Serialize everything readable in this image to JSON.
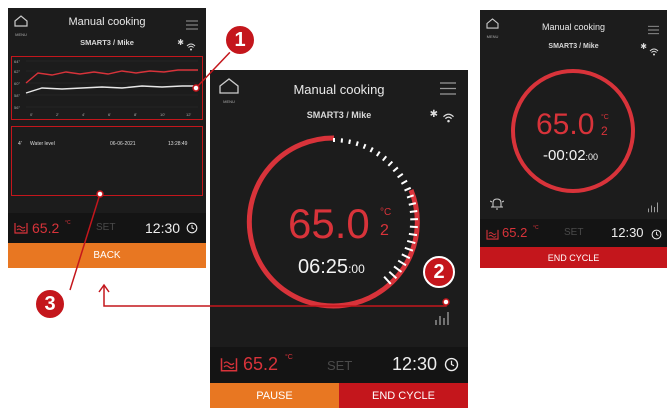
{
  "left": {
    "menu_label": "MENU",
    "title": "Manual cooking",
    "subtitle": "SMART3 / Mike",
    "graph": {
      "y_ticks": [
        "64°",
        "62°",
        "60°",
        "58°",
        "56°"
      ],
      "x_ticks": [
        "0'",
        "2'",
        "4'",
        "6'",
        "8'",
        "10'",
        "12'"
      ]
    },
    "log": {
      "index": "4'",
      "label": "Water level",
      "date": "06-06-2021",
      "time": "13:28:49"
    },
    "status": {
      "temp": "65.2",
      "unit": "°C",
      "set": "SET",
      "clock": "12:30"
    },
    "back_label": "BACK"
  },
  "center": {
    "menu_label": "MENU",
    "title": "Manual cooking",
    "subtitle": "SMART3 / Mike",
    "temp_main": "65.0",
    "temp_unit": "°C",
    "temp_decimal": "2",
    "timer": "06:25",
    "timer_sub": ":00",
    "status": {
      "temp": "65.2",
      "unit": "°C",
      "set": "SET",
      "clock": "12:30"
    },
    "pause_label": "PAUSE",
    "end_label": "END CYCLE"
  },
  "right": {
    "menu_label": "MENU",
    "title": "Manual cooking",
    "subtitle": "SMART3 / Mike",
    "temp_main": "65.0",
    "temp_unit": "°C",
    "temp_decimal": "2",
    "timer": "-00:02",
    "timer_sub": ":00",
    "status": {
      "temp": "65.2",
      "unit": "°C",
      "set": "SET",
      "clock": "12:30"
    },
    "end_label": "END CYCLE"
  },
  "callouts": {
    "one": "1",
    "two": "2",
    "three": "3"
  },
  "colors": {
    "accent_red": "#d8333a",
    "orange": "#e87722",
    "callout_red": "#c4161c"
  }
}
